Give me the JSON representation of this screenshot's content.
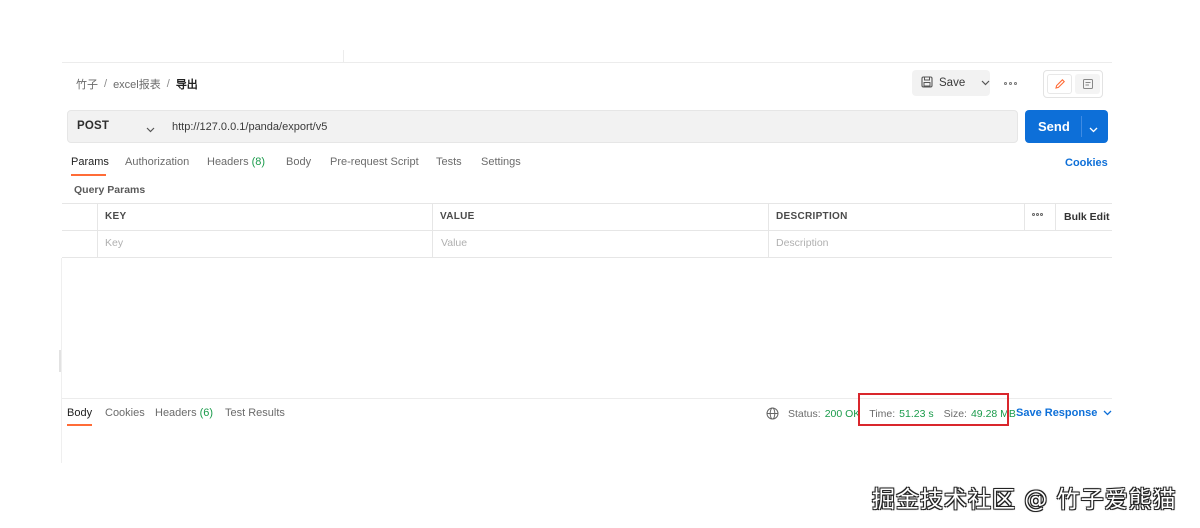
{
  "breadcrumb": {
    "items": [
      "竹子",
      "excel报表"
    ],
    "separator": "/",
    "current": "导出"
  },
  "toolbar": {
    "save_label": "Save"
  },
  "request": {
    "method": "POST",
    "url": "http://127.0.0.1/panda/export/v5",
    "send_label": "Send"
  },
  "request_tabs": {
    "params": "Params",
    "authorization": "Authorization",
    "headers": "Headers",
    "headers_count": "(8)",
    "body": "Body",
    "pre_request": "Pre-request Script",
    "tests": "Tests",
    "settings": "Settings",
    "active": "Params"
  },
  "cookies_link": "Cookies",
  "query_params": {
    "title": "Query Params",
    "columns": [
      "KEY",
      "VALUE",
      "DESCRIPTION"
    ],
    "bulk_edit": "Bulk Edit",
    "placeholders": [
      "Key",
      "Value",
      "Description"
    ]
  },
  "response": {
    "tabs": {
      "body": "Body",
      "cookies": "Cookies",
      "headers": "Headers",
      "headers_count": "(6)",
      "test_results": "Test Results"
    },
    "active_tab": "Body",
    "status_label": "Status:",
    "status_value": "200 OK",
    "time_label": "Time:",
    "time_value": "51.23 s",
    "size_label": "Size:",
    "size_value": "49.28 MB",
    "save_response": "Save Response"
  },
  "watermark": "掘金技术社区 @ 竹子爱熊猫",
  "colors": {
    "accent": "#ff6c37",
    "primary": "#0d6fd8",
    "success": "#1a9b4b",
    "highlight": "#d9262c"
  }
}
